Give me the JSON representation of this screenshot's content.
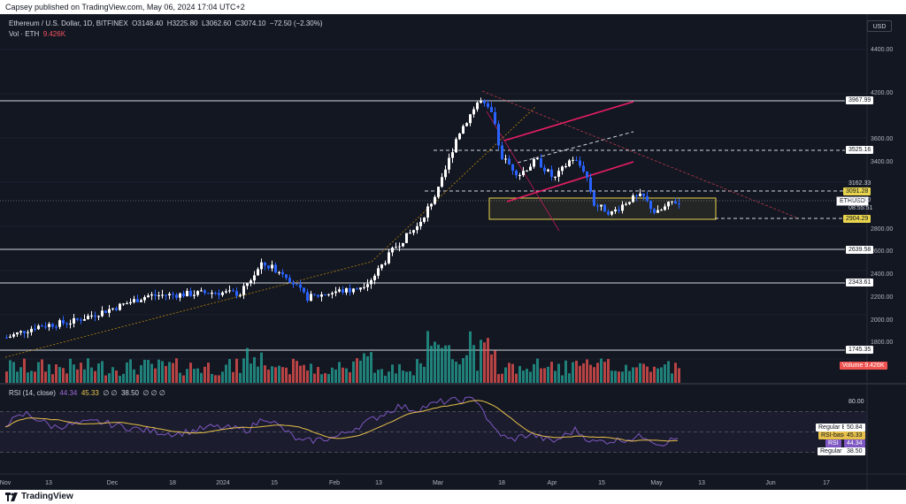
{
  "header": {
    "published": "Capsey published on TradingView.com, May 06, 2024 17:04 UTC+2"
  },
  "legend": {
    "symbol": "Ethereum / U.S. Dollar, 1D, BITFINEX",
    "o_label": "O",
    "o": "3148.40",
    "h_label": "H",
    "h": "3225.80",
    "l_label": "L",
    "l": "3062.60",
    "c_label": "C",
    "c": "3074.10",
    "change": "−72.50 (−2.30%)",
    "vol_label": "Vol · ETH",
    "vol": "9.426K"
  },
  "rsi_legend": {
    "label": "RSI (14, close)",
    "rsi": "44.34",
    "ma": "45.33",
    "n1": "∅",
    "n2": "∅",
    "bull": "38.50",
    "n3": "∅",
    "n4": "∅",
    "n5": "∅"
  },
  "currency": "USD",
  "price_axis": {
    "ticks": [
      "4400.00",
      "4200.00",
      "3600.00",
      "3400.00",
      "2800.00",
      "2600.00",
      "2400.00",
      "2200.00",
      "2000.00",
      "1800.00"
    ]
  },
  "price_labels": {
    "l3967": "3967.99",
    "l3525": "3525.16",
    "l3162": "3162.33",
    "l3091": "3091.28",
    "last": "3074.10",
    "countdown": "08:55:51",
    "symbol_tag": "ETHUSD",
    "l2904": "2904.29",
    "l2639": "2639.58",
    "l2343": "2343.61",
    "l1745": "1745.35",
    "volume_label": "Volume",
    "volume_value": "9.426K"
  },
  "rsi_axis": {
    "top_tick": "80.00"
  },
  "rsi_labels": [
    {
      "name": "Regular Bearish",
      "value": "50.84"
    },
    {
      "name": "RSI-based MA",
      "value": "45.33"
    },
    {
      "name": "RSI",
      "value": "44.34"
    },
    {
      "name": "Regular Bullish",
      "value": "38.50"
    }
  ],
  "time_axis": [
    "Nov",
    "13",
    "Dec",
    "18",
    "2024",
    "15",
    "Feb",
    "13",
    "Mar",
    "18",
    "Apr",
    "15",
    "May",
    "13",
    "Jun",
    "17"
  ],
  "footer": {
    "brand": "TradingView"
  },
  "colors": {
    "bg": "#131722",
    "up": "#ffffff",
    "down": "#2962ff",
    "vol_up": "#26a69a",
    "vol_down": "#ef5350",
    "rsi": "#7e57c2",
    "rsi_ma": "#e6c04a",
    "zone": "#e8d44d",
    "pink": "#e91e63"
  }
}
